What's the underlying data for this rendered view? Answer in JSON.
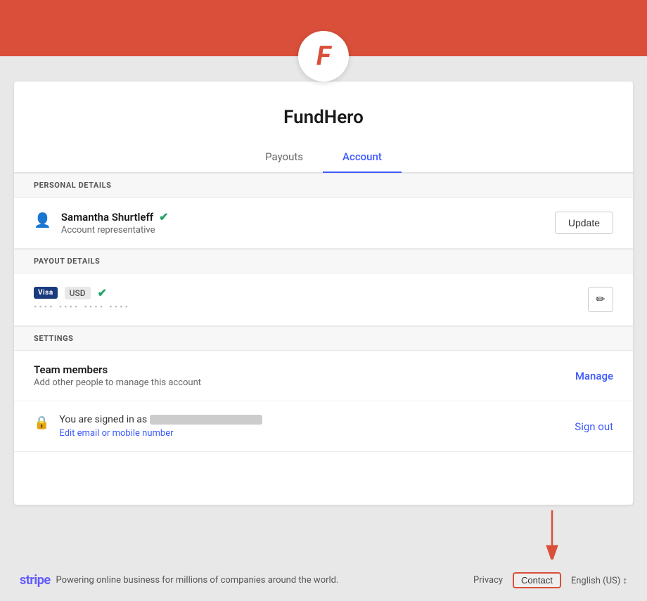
{
  "brand": {
    "logo_letter": "F",
    "app_name": "FundHero",
    "accent_color": "#d94f3a"
  },
  "tabs": {
    "payouts_label": "Payouts",
    "account_label": "Account"
  },
  "personal_details": {
    "section_label": "PERSONAL DETAILS",
    "user_name": "Samantha Shurtleff",
    "user_role": "Account representative",
    "update_button": "Update"
  },
  "payout_details": {
    "section_label": "PAYOUT DETAILS",
    "card_type": "Visa",
    "currency": "USD",
    "card_dots": "•••• •••• •••• ••••"
  },
  "settings": {
    "section_label": "SETTINGS",
    "team_title": "Team members",
    "team_sub": "Add other people to manage this account",
    "manage_label": "Manage",
    "signed_in_prefix": "You are signed in as",
    "edit_email_label": "Edit email or mobile number",
    "signout_label": "Sign out"
  },
  "footer": {
    "stripe_label": "stripe",
    "tagline": "Powering online business for millions of companies around the world.",
    "privacy_label": "Privacy",
    "contact_label": "Contact",
    "language_label": "English (US) ↕"
  }
}
